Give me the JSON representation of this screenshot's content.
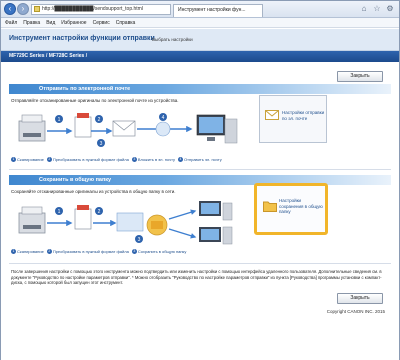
{
  "browser": {
    "url": "http://███████████/sendsupport_top.html",
    "tab_title": "Инструмент настройки фун...",
    "menu": [
      "Файл",
      "Правка",
      "Вид",
      "Избранное",
      "Сервис",
      "Справка"
    ]
  },
  "header": {
    "title": "Инструмент настройки функции отправки",
    "subtitle": "Выбрать настройки"
  },
  "model": "MF729C Series / MF728C Series / ",
  "close_label": "Закрыть",
  "email_section": {
    "title": "Отправить по электронной почте",
    "description": "Отправляйте отсканированные оригиналы по электронной почте из устройства.",
    "steps": [
      {
        "num": "1",
        "text": "Сканирование"
      },
      {
        "num": "2",
        "text": "Преобразовать в нужный формат файла"
      },
      {
        "num": "3",
        "text": "Вложить в эл. почту"
      },
      {
        "num": "4",
        "text": "Отправить эл. почту"
      }
    ],
    "link_label": "Настройки отправки по эл. почте"
  },
  "folder_section": {
    "title": "Сохранить в общую папку",
    "description": "Сохраняйте отсканированные оригиналы из устройства в общую папку в сети.",
    "steps": [
      {
        "num": "1",
        "text": "Сканирование"
      },
      {
        "num": "2",
        "text": "Преобразовать в нужный формат файла"
      },
      {
        "num": "3",
        "text": "Сохранить в общую папку"
      }
    ],
    "link_label": "Настройки сохранения в общую папку"
  },
  "footnote": "После завершения настройки с помощью этого инструмента можно подтвердить или изменить настройки с помощью интерфейса удаленного пользователя. Дополнительные сведения см. в документе \"Руководство по настройке параметров отправки\". * Можно отобразить \"Руководство по настройке параметров отправки\" из пункта [Руководства] программы установки с компакт-диска, с помощью которой был запущен этот инструмент.",
  "copyright": "Copyright CANON INC. 2015",
  "colors": {
    "accent": "#2e63ad",
    "highlight": "#f1b52a",
    "header_bg": "#dfe9f5"
  }
}
